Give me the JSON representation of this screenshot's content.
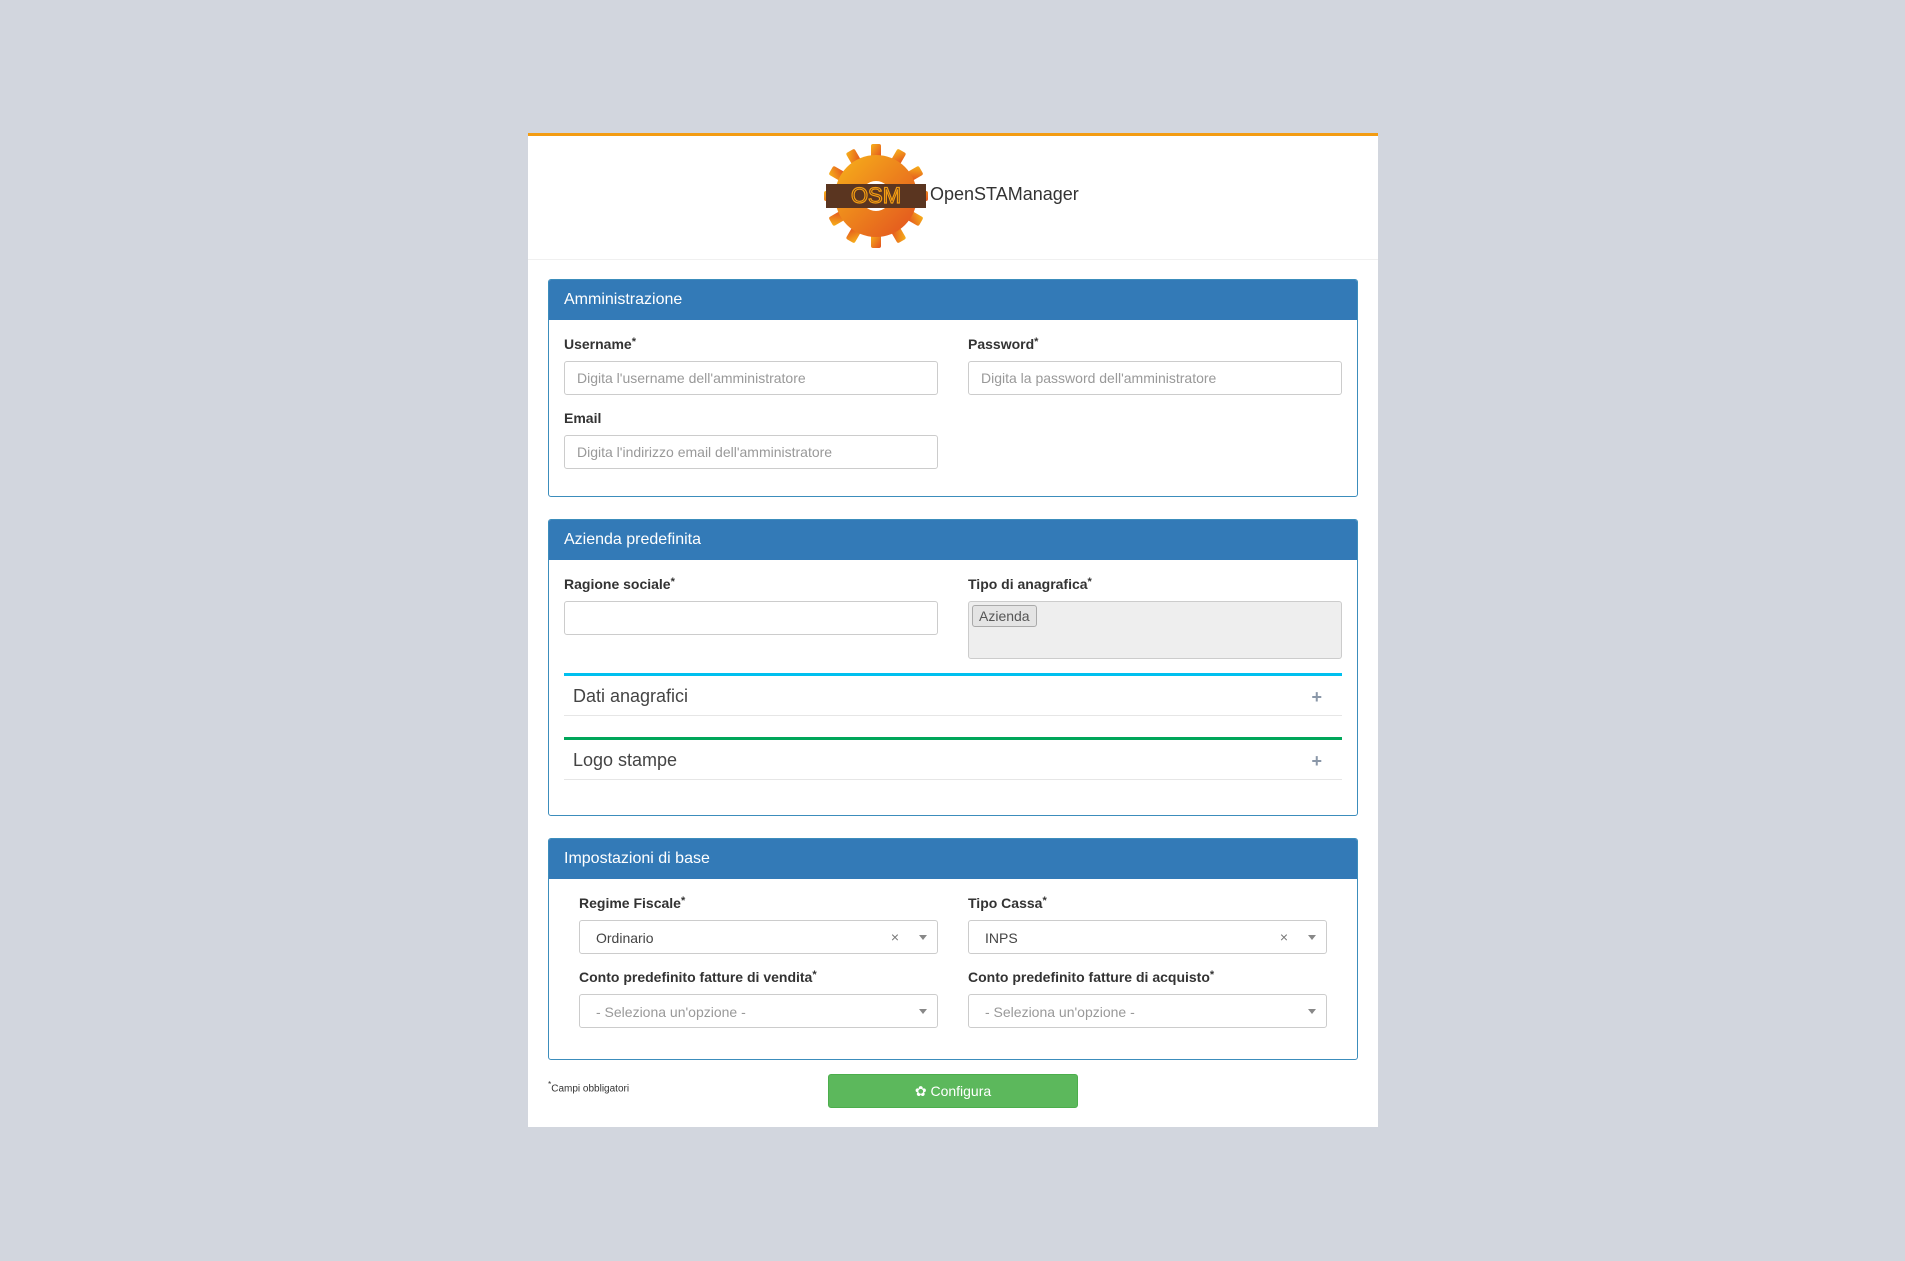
{
  "brand": {
    "name": "OpenSTAManager",
    "logo_text": "OSM"
  },
  "admin": {
    "title": "Amministrazione",
    "username_label": "Username",
    "username_placeholder": "Digita l'username dell'amministratore",
    "password_label": "Password",
    "password_placeholder": "Digita la password dell'amministratore",
    "email_label": "Email",
    "email_placeholder": "Digita l'indirizzo email dell'amministratore"
  },
  "company": {
    "title": "Azienda predefinita",
    "name_label": "Ragione sociale",
    "name_value": "",
    "type_label": "Tipo di anagrafica",
    "type_tags": [
      "Azienda"
    ],
    "sections": [
      {
        "title": "Dati anagrafici",
        "accent": "#00c0ef"
      },
      {
        "title": "Logo stampe",
        "accent": "#00a65a"
      }
    ]
  },
  "settings": {
    "title": "Impostazioni di base",
    "regime_label": "Regime Fiscale",
    "regime_value": "Ordinario",
    "cassa_label": "Tipo Cassa",
    "cassa_value": "INPS",
    "sales_label": "Conto predefinito fatture di vendita",
    "sales_value": "- Seleziona un'opzione -",
    "purchase_label": "Conto predefinito fatture di acquisto",
    "purchase_value": "- Seleziona un'opzione -"
  },
  "footer": {
    "required_mark": "*",
    "required_note": "Campi obbligatori",
    "configure_label": "Configura"
  },
  "icons": {
    "clear": "clear-icon",
    "configure": "gear-icon",
    "expand": "plus-icon"
  },
  "colors": {
    "accent_top": "#f39c12",
    "panel_head": "#337ab7",
    "button": "#5cb85c"
  }
}
